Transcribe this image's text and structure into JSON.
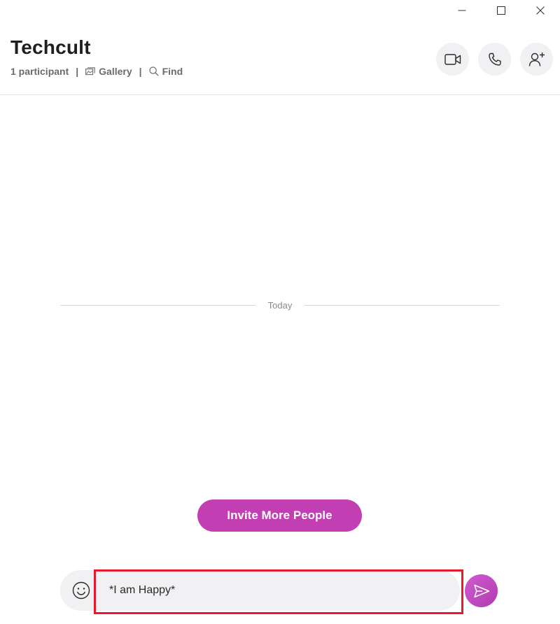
{
  "window": {
    "controls": [
      "minimize",
      "maximize",
      "close"
    ]
  },
  "header": {
    "title": "Techcult",
    "participants": "1 participant",
    "gallery_label": "Gallery",
    "find_label": "Find",
    "separator": "|",
    "actions": [
      "video-call",
      "audio-call",
      "add-people"
    ]
  },
  "conversation": {
    "date_divider": "Today"
  },
  "invite": {
    "label": "Invite More People"
  },
  "composer": {
    "message_value": "*I am Happy*",
    "highlight_color": "#e8192c"
  },
  "colors": {
    "accent": "#c13fb3",
    "button_bg": "#f1f1f3"
  }
}
